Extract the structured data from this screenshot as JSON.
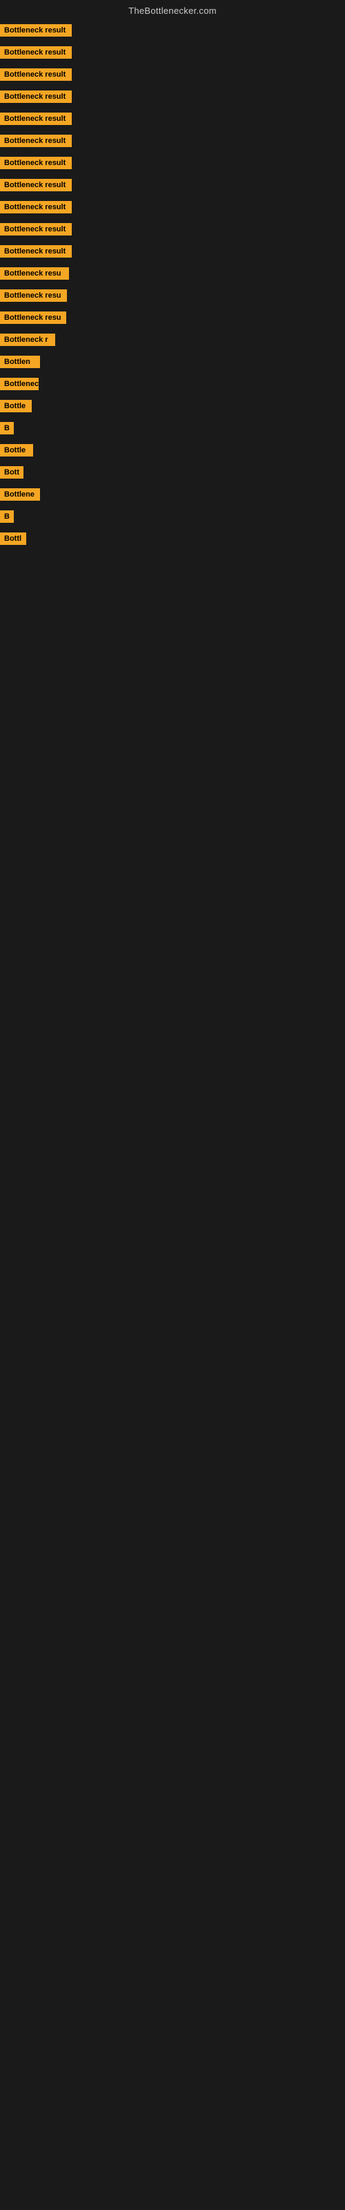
{
  "header": {
    "title": "TheBottlenecker.com"
  },
  "items": [
    {
      "id": 1,
      "badge_text": "Bottleneck result",
      "visible_width": "full"
    },
    {
      "id": 2,
      "badge_text": "Bottleneck result",
      "visible_width": "full"
    },
    {
      "id": 3,
      "badge_text": "Bottleneck result",
      "visible_width": "full"
    },
    {
      "id": 4,
      "badge_text": "Bottleneck result",
      "visible_width": "full"
    },
    {
      "id": 5,
      "badge_text": "Bottleneck result",
      "visible_width": "full"
    },
    {
      "id": 6,
      "badge_text": "Bottleneck result",
      "visible_width": "full"
    },
    {
      "id": 7,
      "badge_text": "Bottleneck result",
      "visible_width": "full"
    },
    {
      "id": 8,
      "badge_text": "Bottleneck result",
      "visible_width": "full"
    },
    {
      "id": 9,
      "badge_text": "Bottleneck result",
      "visible_width": "full"
    },
    {
      "id": 10,
      "badge_text": "Bottleneck result",
      "visible_width": "full"
    },
    {
      "id": 11,
      "badge_text": "Bottleneck result",
      "visible_width": "full"
    },
    {
      "id": 12,
      "badge_text": "Bottleneck resu",
      "visible_width": "partial"
    },
    {
      "id": 13,
      "badge_text": "Bottleneck resu",
      "visible_width": "partial"
    },
    {
      "id": 14,
      "badge_text": "Bottleneck resu",
      "visible_width": "partial"
    },
    {
      "id": 15,
      "badge_text": "Bottleneck r",
      "visible_width": "partial"
    },
    {
      "id": 16,
      "badge_text": "Bottlen",
      "visible_width": "partial"
    },
    {
      "id": 17,
      "badge_text": "Bottleneck",
      "visible_width": "partial"
    },
    {
      "id": 18,
      "badge_text": "Bottle",
      "visible_width": "partial"
    },
    {
      "id": 19,
      "badge_text": "B",
      "visible_width": "partial"
    },
    {
      "id": 20,
      "badge_text": "Bottle",
      "visible_width": "partial"
    },
    {
      "id": 21,
      "badge_text": "Bott",
      "visible_width": "partial"
    },
    {
      "id": 22,
      "badge_text": "Bottlene",
      "visible_width": "partial"
    },
    {
      "id": 23,
      "badge_text": "B",
      "visible_width": "partial"
    },
    {
      "id": 24,
      "badge_text": "Bottl",
      "visible_width": "partial"
    }
  ],
  "colors": {
    "badge_bg": "#f5a623",
    "badge_text": "#000000",
    "page_bg": "#1a1a1a",
    "header_text": "#cccccc"
  }
}
